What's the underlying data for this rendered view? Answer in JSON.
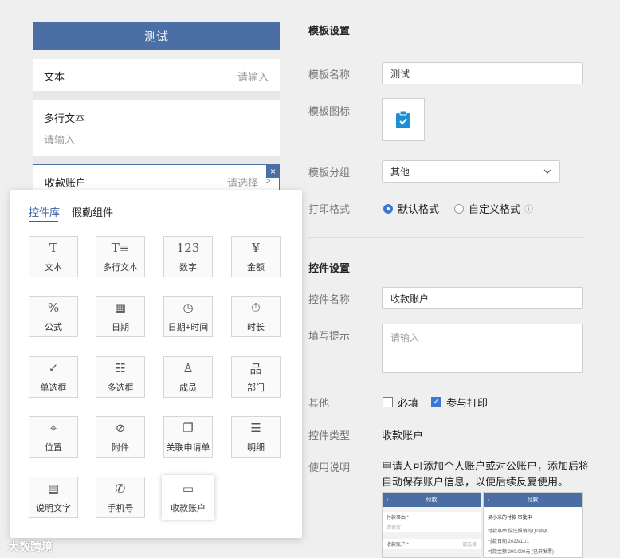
{
  "preview": {
    "title": "测试",
    "fields": [
      {
        "label": "文本",
        "placeholder": "请输入"
      },
      {
        "label": "多行文本",
        "placeholder": "请输入"
      },
      {
        "label": "收款账户",
        "placeholder": "请选择"
      }
    ],
    "close_glyph": "×",
    "chevron_glyph": ">"
  },
  "palette": {
    "tabs": [
      "控件库",
      "假勤组件"
    ],
    "active_tab": 0,
    "tiles": [
      {
        "label": "文本",
        "icon": "text-icon",
        "glyph": "T"
      },
      {
        "label": "多行文本",
        "icon": "multiline-text-icon",
        "glyph": "T≡"
      },
      {
        "label": "数字",
        "icon": "number-icon",
        "glyph": "123"
      },
      {
        "label": "金额",
        "icon": "yen-icon",
        "glyph": "¥"
      },
      {
        "label": "公式",
        "icon": "formula-icon",
        "glyph": "%"
      },
      {
        "label": "日期",
        "icon": "calendar-icon",
        "glyph": "▦"
      },
      {
        "label": "日期+时间",
        "icon": "calendar-clock-icon",
        "glyph": "◷"
      },
      {
        "label": "时长",
        "icon": "stopwatch-icon",
        "glyph": "⏱"
      },
      {
        "label": "单选框",
        "icon": "radio-check-icon",
        "glyph": "✓"
      },
      {
        "label": "多选框",
        "icon": "checklist-icon",
        "glyph": "☷"
      },
      {
        "label": "成员",
        "icon": "person-icon",
        "glyph": "♙"
      },
      {
        "label": "部门",
        "icon": "org-chart-icon",
        "glyph": "品"
      },
      {
        "label": "位置",
        "icon": "location-pin-icon",
        "glyph": "⌖"
      },
      {
        "label": "附件",
        "icon": "paperclip-icon",
        "glyph": "⊘"
      },
      {
        "label": "关联申请单",
        "icon": "linked-form-icon",
        "glyph": "❐"
      },
      {
        "label": "明细",
        "icon": "detail-list-icon",
        "glyph": "☰"
      },
      {
        "label": "说明文字",
        "icon": "note-doc-icon",
        "glyph": "▤"
      },
      {
        "label": "手机号",
        "icon": "phone-icon",
        "glyph": "✆"
      },
      {
        "label": "收款账户",
        "icon": "bank-card-icon",
        "glyph": "▭"
      }
    ],
    "highlighted_tile": 18
  },
  "template_settings": {
    "section_title": "模板设置",
    "name_label": "模板名称",
    "name_value": "测试",
    "icon_label": "模板图标",
    "group_label": "模板分组",
    "group_value": "其他",
    "print_label": "打印格式",
    "print_options": [
      "默认格式",
      "自定义格式"
    ],
    "print_selected": 0,
    "info_glyph": "ⓘ"
  },
  "control_settings": {
    "section_title": "控件设置",
    "name_label": "控件名称",
    "name_value": "收款账户",
    "hint_label": "填写提示",
    "hint_placeholder": "请输入",
    "other_label": "其他",
    "required_label": "必填",
    "required_checked": false,
    "print_label": "参与打印",
    "print_checked": true,
    "type_label": "控件类型",
    "type_value": "收款账户",
    "usage_label": "使用说明",
    "usage_text": "申请人可添加个人账户或对公账户，添加后将自动保存账户信息，以便后续反复使用。"
  },
  "sample_screens": {
    "left": {
      "title": "付款",
      "lines": [
        "付款事由 *",
        "请填写",
        "收款账户 *",
        "请选择"
      ]
    },
    "right": {
      "title": "付款",
      "user_line": "吴小米的付款 审批中",
      "lines": [
        "付款事由   偿还报销的Q2款项",
        "付款日期   2023/11/1",
        "付款金额   200.000元 (已开发票)"
      ]
    }
  },
  "watermark": "大数跨境",
  "colors": {
    "primary": "#4b6fa5",
    "accent": "#3c77d6",
    "icon_bg": "#1d8fd6"
  }
}
